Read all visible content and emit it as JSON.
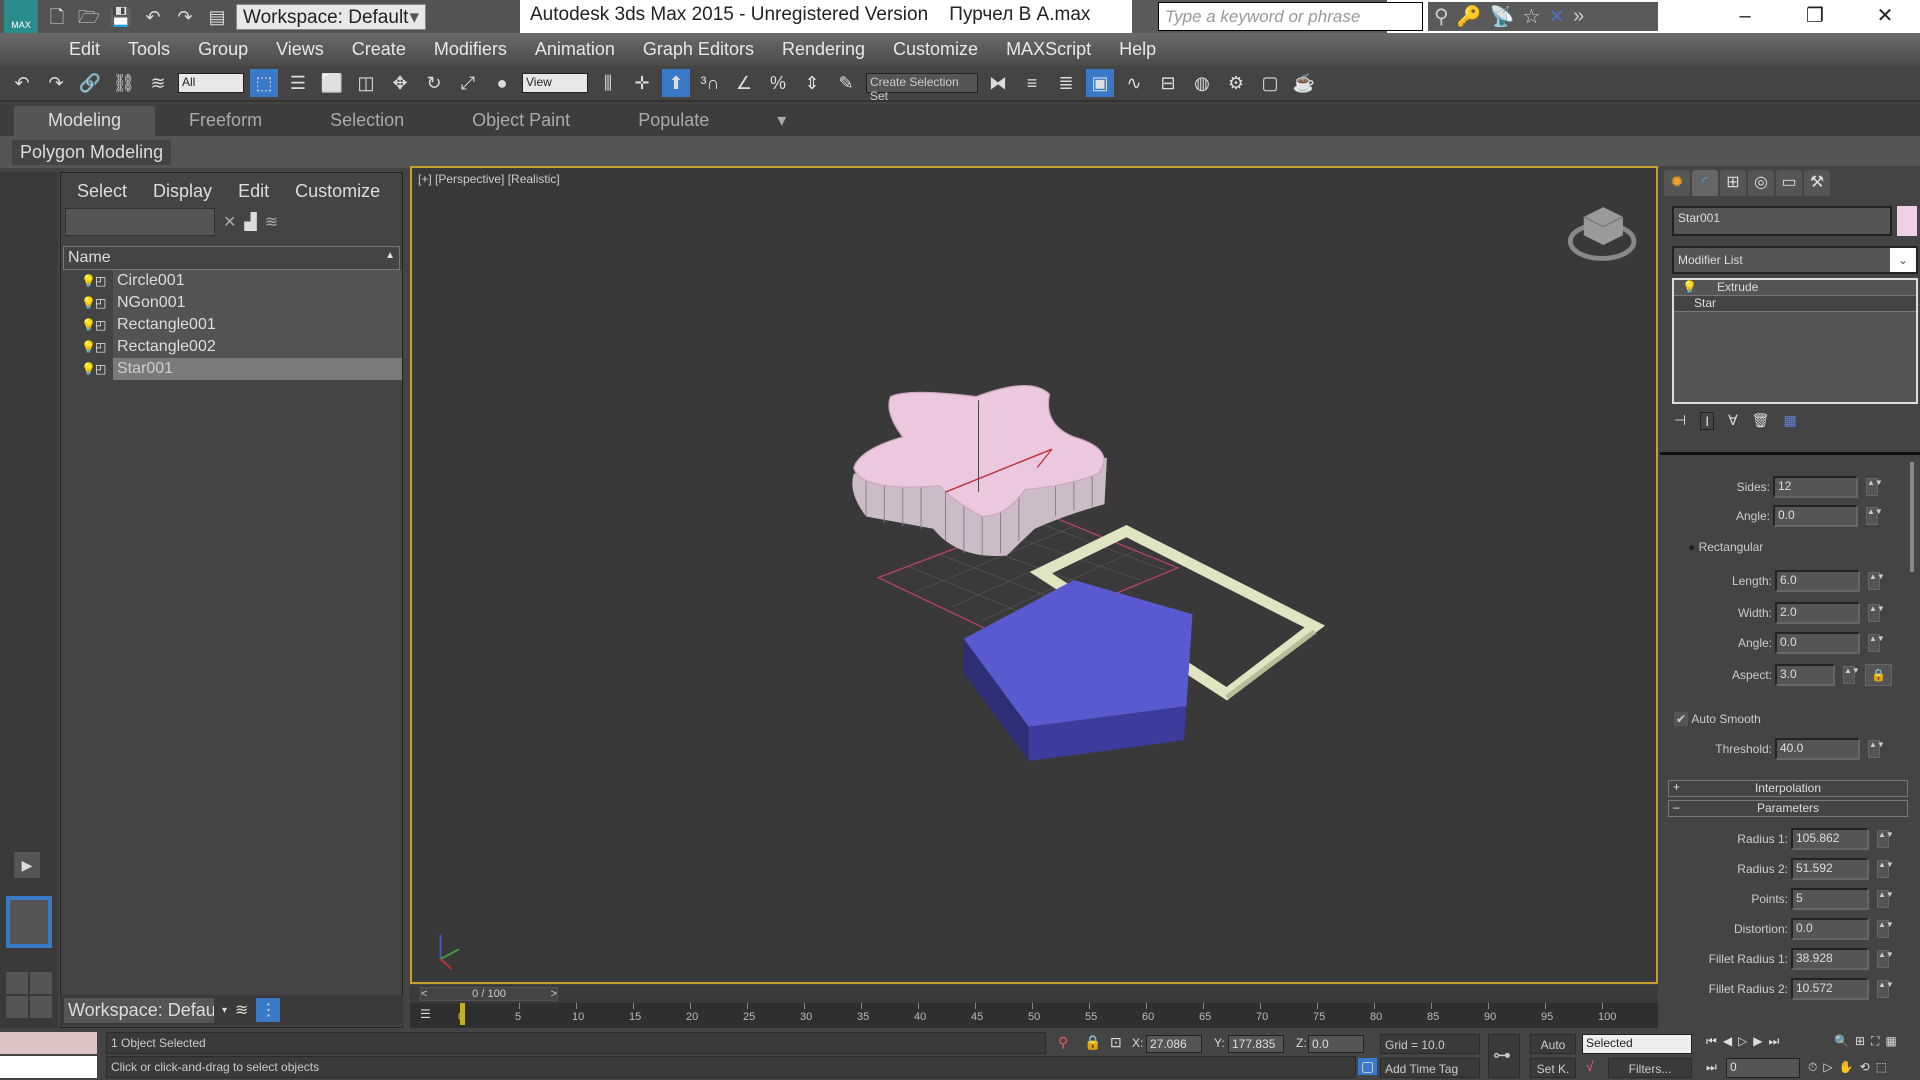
{
  "app": {
    "title": "Autodesk 3ds Max  2015  - Unregistered Version",
    "file": "Пурчел В А.max",
    "logo_text": "MAX",
    "workspace": "Workspace: Default",
    "search_placeholder": "Type a keyword or phrase"
  },
  "menu": [
    "Edit",
    "Tools",
    "Group",
    "Views",
    "Create",
    "Modifiers",
    "Animation",
    "Graph Editors",
    "Rendering",
    "Customize",
    "MAXScript",
    "Help"
  ],
  "toolbar": {
    "selection_filter": "All",
    "ref_coord": "View",
    "named_selection": "Create Selection Set"
  },
  "ribbon": {
    "tabs": [
      "Modeling",
      "Freeform",
      "Selection",
      "Object Paint",
      "Populate"
    ],
    "active": "Modeling",
    "panel": "Polygon Modeling"
  },
  "explorer": {
    "menu": [
      "Select",
      "Display",
      "Edit",
      "Customize"
    ],
    "column": "Name",
    "items": [
      "Circle001",
      "NGon001",
      "Rectangle001",
      "Rectangle002",
      "Star001"
    ],
    "selected": "Star001",
    "workspace": "Workspace: Defau"
  },
  "viewport": {
    "label": "[+] [Perspective] [Realistic]"
  },
  "command_panel": {
    "object_name": "Star001",
    "object_color": "#f0d0e8",
    "modifier_list": "Modifier List",
    "stack": [
      "Extrude",
      "Star"
    ],
    "sides_label": "Sides:",
    "sides": "12",
    "angle_label": "Angle:",
    "angle": "0.0",
    "rectangular_label": "Rectangular",
    "length_label": "Length:",
    "length": "6.0",
    "width_label": "Width:",
    "width": "2.0",
    "angle2": "0.0",
    "aspect_label": "Aspect:",
    "aspect": "3.0",
    "auto_smooth_label": "Auto Smooth",
    "auto_smooth": true,
    "threshold_label": "Threshold:",
    "threshold": "40.0",
    "rollout_interpolation": "Interpolation",
    "rollout_parameters": "Parameters",
    "params": [
      {
        "label": "Radius 1:",
        "value": "105.862"
      },
      {
        "label": "Radius 2:",
        "value": "51.592"
      },
      {
        "label": "Points:",
        "value": "5"
      },
      {
        "label": "Distortion:",
        "value": "0.0"
      },
      {
        "label": "Fillet Radius 1:",
        "value": "38.928"
      },
      {
        "label": "Fillet Radius 2:",
        "value": "10.572"
      }
    ]
  },
  "timeline": {
    "frame": "0 / 100",
    "ticks": [
      "0",
      "5",
      "10",
      "15",
      "20",
      "25",
      "30",
      "35",
      "40",
      "45",
      "50",
      "55",
      "60",
      "65",
      "70",
      "75",
      "80",
      "85",
      "90",
      "95",
      "100"
    ]
  },
  "status": {
    "selection": "1 Object Selected",
    "prompt": "Click or click-and-drag to select objects",
    "x_label": "X:",
    "x": "27.086",
    "y_label": "Y:",
    "y": "177.835",
    "z_label": "Z:",
    "z": "0.0",
    "grid": "Grid = 10.0",
    "add_time_tag": "Add Time Tag",
    "auto": "Auto",
    "set_key": "Set K.",
    "key_filter": "Selected",
    "filters": "Filters...",
    "current_frame": "0"
  },
  "colors": {
    "accent": "#3a78c8",
    "viewport_border": "#c8a030",
    "star": "#ecc8e0",
    "ngon": "#5a5ad0",
    "rect": "#e0e4c0"
  }
}
